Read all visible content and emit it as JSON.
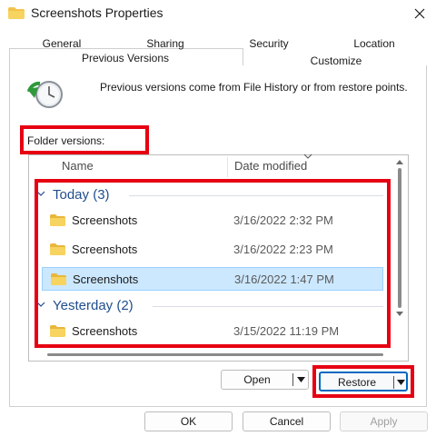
{
  "window": {
    "title": "Screenshots Properties"
  },
  "tabs": [
    {
      "label": "General"
    },
    {
      "label": "Sharing"
    },
    {
      "label": "Security"
    },
    {
      "label": "Location"
    },
    {
      "label": "Previous Versions",
      "selected": true
    },
    {
      "label": "Customize"
    }
  ],
  "info": {
    "text": "Previous versions come from File History or from restore points."
  },
  "folder_versions": {
    "label": "Folder versions:",
    "columns": {
      "name": "Name",
      "date": "Date modified"
    },
    "groups": [
      {
        "header": "Today (3)",
        "items": [
          {
            "name": "Screenshots",
            "date": "3/16/2022 2:32 PM",
            "selected": false
          },
          {
            "name": "Screenshots",
            "date": "3/16/2022 2:23 PM",
            "selected": false
          },
          {
            "name": "Screenshots",
            "date": "3/16/2022 1:47 PM",
            "selected": true
          }
        ]
      },
      {
        "header": "Yesterday (2)",
        "items": [
          {
            "name": "Screenshots",
            "date": "3/15/2022 11:19 PM",
            "selected": false
          }
        ]
      }
    ]
  },
  "actions": {
    "open": "Open",
    "restore": "Restore"
  },
  "footer": {
    "ok": "OK",
    "cancel": "Cancel",
    "apply": "Apply",
    "apply_enabled": false
  },
  "colors": {
    "highlight": "#e60012",
    "group_header": "#1f4e8c",
    "selected_row": "#cce8ff",
    "accent": "#0067c0",
    "folder": "#f2c34c"
  },
  "icons": {
    "title": "folder-icon",
    "close": "close-icon",
    "history": "restore-clock-icon",
    "rows": "folder-icon",
    "dropdown": "chevron-down-icon"
  }
}
